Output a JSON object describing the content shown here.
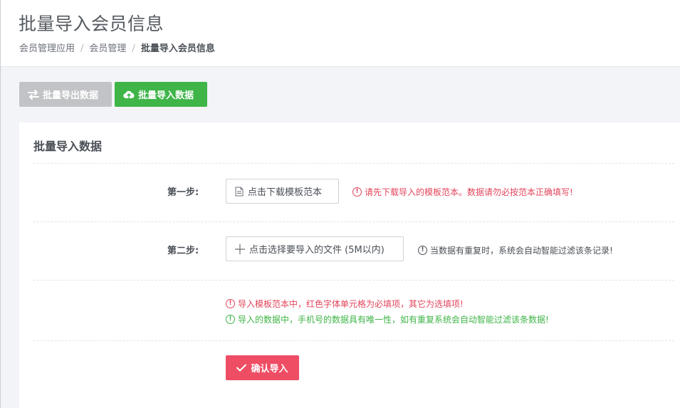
{
  "header": {
    "title": "批量导入会员信息",
    "breadcrumb": [
      "会员管理应用",
      "会员管理",
      "批量导入会员信息"
    ],
    "separator": "/"
  },
  "toolbar": {
    "export_label": "批量导出数据",
    "import_label": "批量导入数据"
  },
  "card": {
    "title": "批量导入数据",
    "step1": {
      "label": "第一步:",
      "button": "点击下载模板范本",
      "hint": "请先下载导入的模板范本。数据请勿必按范本正确填写!"
    },
    "step2": {
      "label": "第二步:",
      "button": "点击选择要导入的文件 (5M以内)",
      "hint": "当数据有重复时，系统会自动智能过滤该条记录!"
    },
    "notes": {
      "required": "导入模板范本中，红色字体单元格为必填项，其它为选填项!",
      "unique": "导入的数据中，手机号的数据具有唯一性，如有重复系统会自动智能过滤该条数据!"
    },
    "confirm_label": "确认导入"
  },
  "colors": {
    "green": "#3fb548",
    "red": "#e2455b",
    "gray_button": "#c2c3c6",
    "confirm": "#ee4d64"
  }
}
